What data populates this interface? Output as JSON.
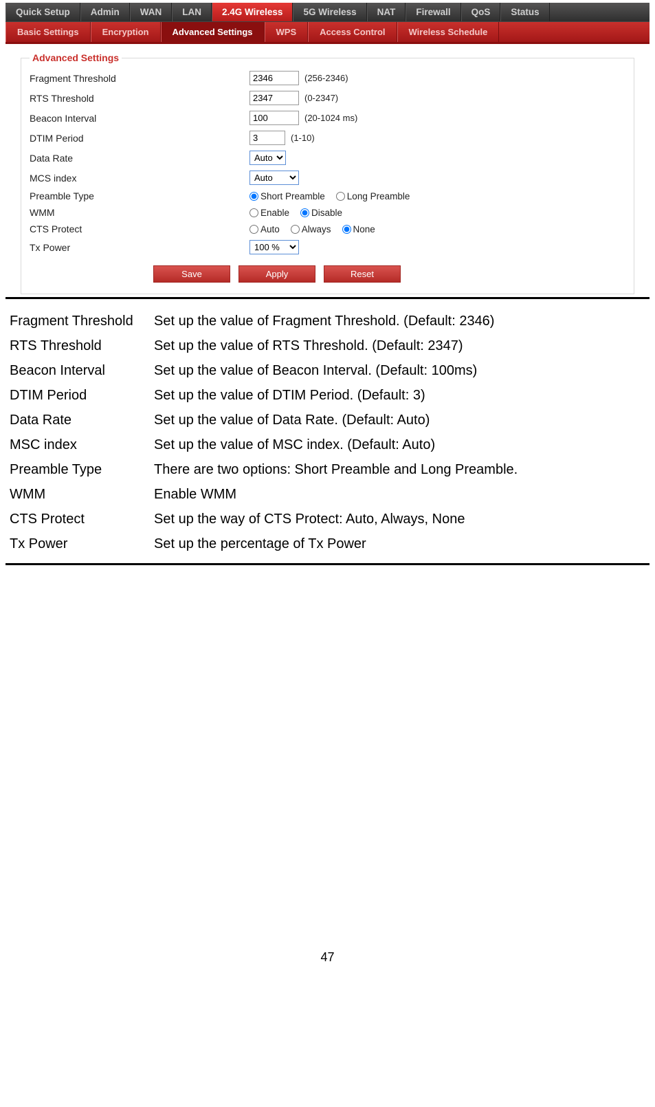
{
  "nav1": {
    "items": [
      {
        "label": "Quick Setup",
        "active": false
      },
      {
        "label": "Admin",
        "active": false
      },
      {
        "label": "WAN",
        "active": false
      },
      {
        "label": "LAN",
        "active": false
      },
      {
        "label": "2.4G Wireless",
        "active": true
      },
      {
        "label": "5G Wireless",
        "active": false
      },
      {
        "label": "NAT",
        "active": false
      },
      {
        "label": "Firewall",
        "active": false
      },
      {
        "label": "QoS",
        "active": false
      },
      {
        "label": "Status",
        "active": false
      }
    ]
  },
  "nav2": {
    "items": [
      {
        "label": "Basic Settings",
        "active": false
      },
      {
        "label": "Encryption",
        "active": false
      },
      {
        "label": "Advanced Settings",
        "active": true
      },
      {
        "label": "WPS",
        "active": false
      },
      {
        "label": "Access Control",
        "active": false
      },
      {
        "label": "Wireless Schedule",
        "active": false
      }
    ]
  },
  "panel": {
    "legend": "Advanced Settings",
    "rows": {
      "fragment": {
        "label": "Fragment Threshold",
        "value": "2346",
        "hint": "(256-2346)"
      },
      "rts": {
        "label": "RTS Threshold",
        "value": "2347",
        "hint": "(0-2347)"
      },
      "beacon": {
        "label": "Beacon Interval",
        "value": "100",
        "hint": "(20-1024 ms)"
      },
      "dtim": {
        "label": "DTIM Period",
        "value": "3",
        "hint": "(1-10)"
      },
      "dataRate": {
        "label": "Data Rate",
        "selected": "Auto"
      },
      "mcs": {
        "label": "MCS index",
        "selected": "Auto"
      },
      "preamble": {
        "label": "Preamble Type",
        "options": [
          {
            "label": "Short Preamble",
            "checked": true
          },
          {
            "label": "Long Preamble",
            "checked": false
          }
        ]
      },
      "wmm": {
        "label": "WMM",
        "options": [
          {
            "label": "Enable",
            "checked": false
          },
          {
            "label": "Disable",
            "checked": true
          }
        ]
      },
      "cts": {
        "label": "CTS Protect",
        "options": [
          {
            "label": "Auto",
            "checked": false
          },
          {
            "label": "Always",
            "checked": false
          },
          {
            "label": "None",
            "checked": true
          }
        ]
      },
      "txpower": {
        "label": "Tx Power",
        "selected": "100 %"
      }
    },
    "buttons": {
      "save": "Save",
      "apply": "Apply",
      "reset": "Reset"
    }
  },
  "descriptions": [
    {
      "k": "Fragment Threshold",
      "v": "Set up the value of Fragment Threshold. (Default: 2346)"
    },
    {
      "k": "RTS Threshold",
      "v": "Set up the value of RTS Threshold. (Default: 2347)"
    },
    {
      "k": "Beacon Interval",
      "v": "Set up the value of Beacon Interval. (Default: 100ms)"
    },
    {
      "k": "DTIM Period",
      "v": "Set up the value of DTIM Period. (Default: 3)"
    },
    {
      "k": "Data Rate",
      "v": "Set up the value of Data Rate. (Default: Auto)"
    },
    {
      "k": "MSC index",
      "v": "Set up the value of MSC index. (Default: Auto)"
    },
    {
      "k": "Preamble Type",
      "v": "There are two options: Short Preamble and Long Preamble."
    },
    {
      "k": "WMM",
      "v": "Enable WMM"
    },
    {
      "k": "CTS Protect",
      "v": "Set up the way of CTS Protect: Auto, Always, None"
    },
    {
      "k": "Tx Power",
      "v": "Set up the percentage of Tx Power"
    }
  ],
  "pageNumber": "47"
}
